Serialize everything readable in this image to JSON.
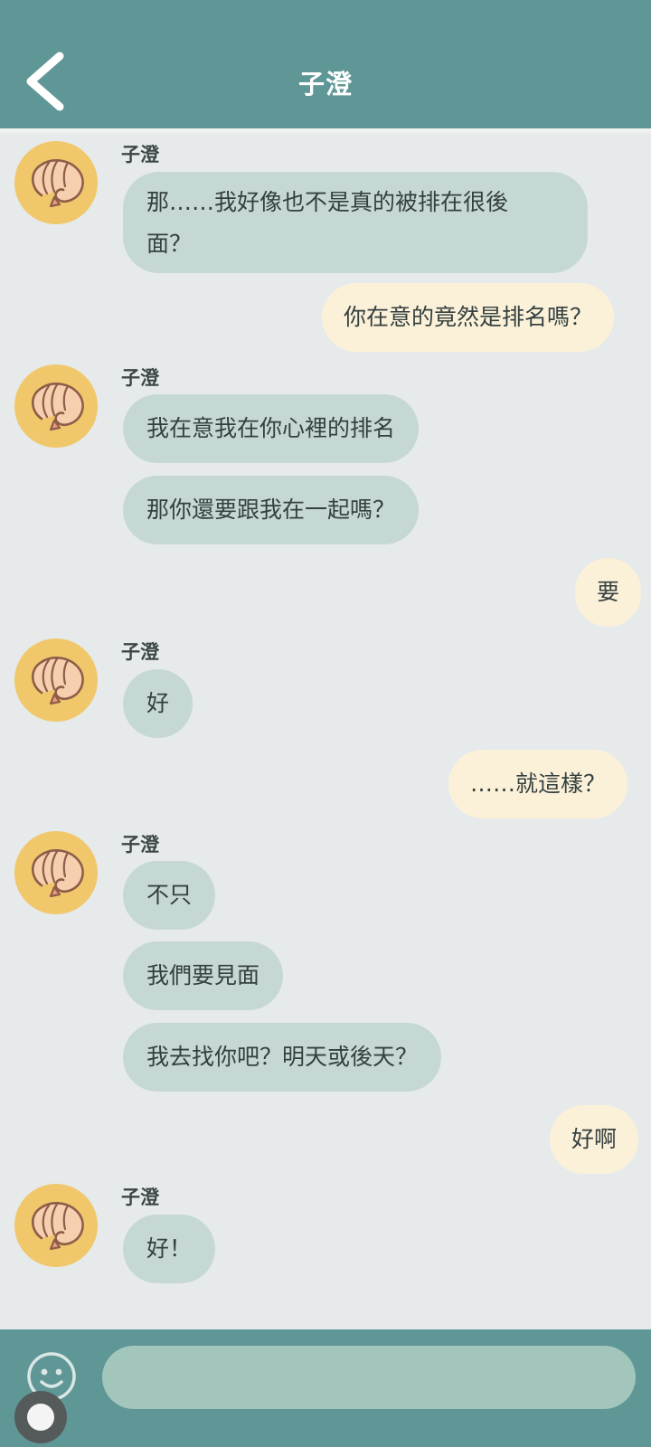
{
  "header": {
    "title": "子澄",
    "back_icon": "chevron-left-icon"
  },
  "messages": {
    "m1": {
      "sender": "子澄",
      "text1": "那……我好像也不是真的被排在很後",
      "text2": "面？"
    },
    "m2": {
      "text": "你在意的竟然是排名嗎？"
    },
    "m3": {
      "sender": "子澄",
      "text_a": "我在意我在你心裡的排名",
      "text_b": "那你還要跟我在一起嗎？"
    },
    "m4": {
      "text": "要"
    },
    "m5": {
      "sender": "子澄",
      "text": "好"
    },
    "m6": {
      "text": "……就這樣？"
    },
    "m7": {
      "sender": "子澄",
      "text_a": "不只",
      "text_b": "我們要見面",
      "text_c": "我去找你吧？明天或後天？"
    },
    "m8": {
      "text": "好啊"
    },
    "m9": {
      "sender": "子澄",
      "text": "好！"
    }
  },
  "avatar_icon": "shrimp-avatar-icon",
  "composer": {
    "emoji_icon": "smiley-icon",
    "input_value": "",
    "input_placeholder": ""
  },
  "colors": {
    "header": "#5f9696",
    "background": "#e6eaea",
    "incoming_bubble": "#c6d8d6",
    "outgoing_bubble": "#fbf1d9",
    "avatar": "#f1c76b",
    "input": "#a2c5bc"
  }
}
